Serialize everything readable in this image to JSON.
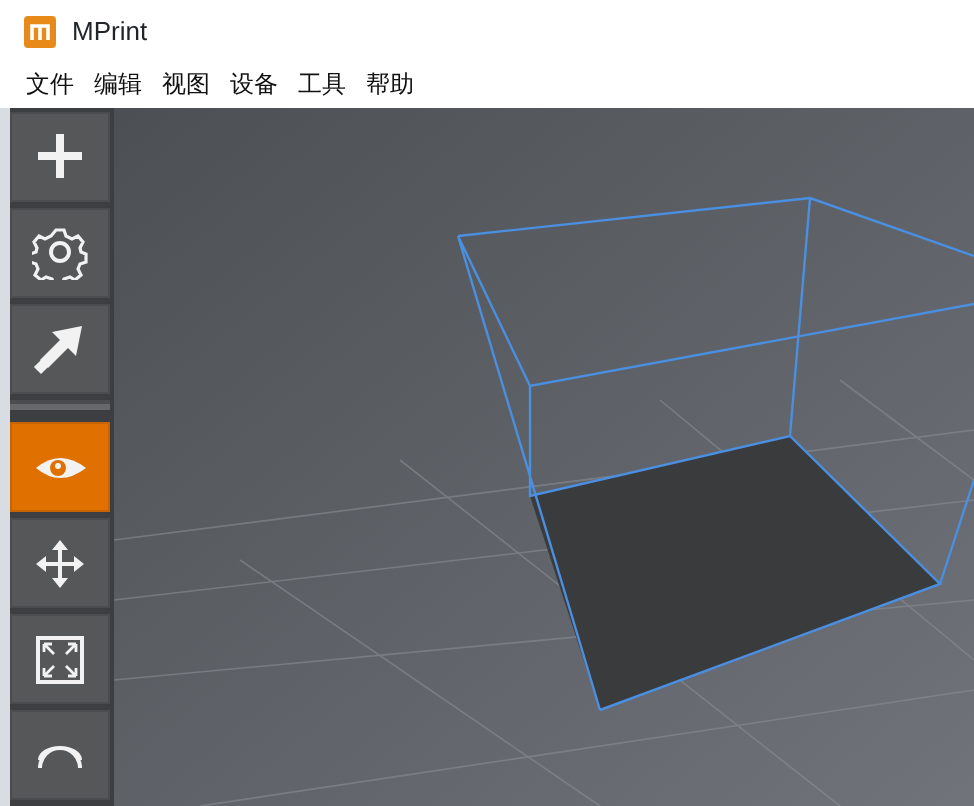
{
  "window": {
    "title": "MPrint"
  },
  "menu": [
    "文件",
    "编辑",
    "视图",
    "设备",
    "工具",
    "帮助"
  ],
  "toolbar": [
    {
      "kind": "add",
      "selected": false
    },
    {
      "kind": "settings",
      "selected": false
    },
    {
      "kind": "arrow",
      "selected": false
    },
    {
      "kind": "separator"
    },
    {
      "kind": "view",
      "selected": true
    },
    {
      "kind": "move",
      "selected": false
    },
    {
      "kind": "scale",
      "selected": false
    },
    {
      "kind": "rotate",
      "selected": false
    }
  ]
}
